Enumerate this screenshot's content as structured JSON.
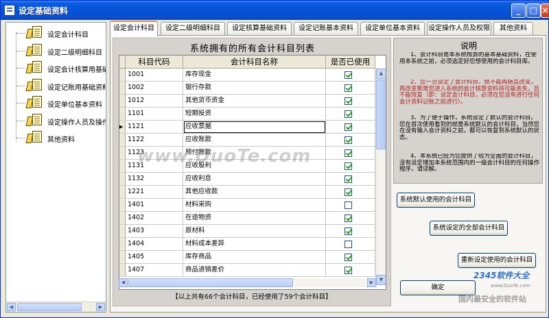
{
  "window": {
    "title": "设定基础资料",
    "min": "_",
    "max": "□",
    "close": "×"
  },
  "tree": {
    "items": [
      {
        "label": "设定会计科目"
      },
      {
        "label": "设定二级明细科目"
      },
      {
        "label": "设定会计核算用基础"
      },
      {
        "label": "设定记账用基础资料"
      },
      {
        "label": "设定单位基本资料"
      },
      {
        "label": "设定操作人员及操作"
      },
      {
        "label": "其他资料"
      }
    ]
  },
  "tabs": [
    {
      "label": "设定会计科目",
      "active": true
    },
    {
      "label": "设定二级明细科目"
    },
    {
      "label": "设定核算基础资料"
    },
    {
      "label": "设定记账基本资料"
    },
    {
      "label": "设定单位基本资料"
    },
    {
      "label": "设定操作人员及权限"
    },
    {
      "label": "其他资料"
    }
  ],
  "grid": {
    "title": "系统拥有的所有会计科目列表",
    "columns": [
      "科目代码",
      "会计科目名称",
      "是否已使用"
    ],
    "rows": [
      {
        "code": "1001",
        "name": "库存现金",
        "used": true
      },
      {
        "code": "1002",
        "name": "银行存款",
        "used": true
      },
      {
        "code": "1012",
        "name": "其他货币资金",
        "used": true
      },
      {
        "code": "1101",
        "name": "短期投资",
        "used": true
      },
      {
        "code": "1121",
        "name": "应收票据",
        "used": true,
        "current": true
      },
      {
        "code": "1122",
        "name": "应收账款",
        "used": true
      },
      {
        "code": "1123",
        "name": "预付账款",
        "used": true
      },
      {
        "code": "1131",
        "name": "应收股利",
        "used": true
      },
      {
        "code": "1132",
        "name": "应收利息",
        "used": true
      },
      {
        "code": "1221",
        "name": "其他应收款",
        "used": true
      },
      {
        "code": "1401",
        "name": "材料采购",
        "used": false
      },
      {
        "code": "1402",
        "name": "在途物资",
        "used": true
      },
      {
        "code": "1403",
        "name": "原材料",
        "used": true
      },
      {
        "code": "1404",
        "name": "材料成本差异",
        "used": false
      },
      {
        "code": "1405",
        "name": "库存商品",
        "used": true
      },
      {
        "code": "1407",
        "name": "商品进销差价",
        "used": true
      }
    ],
    "row_marker": "▶",
    "footer": "【以上共有66个会计科目，已经使用了59个会计科目】"
  },
  "note": {
    "title": "说明",
    "p1": "1、会计科目是本系统核算的基本基础资料，在使用本系统之前，必须选定好您想使用的会计科目库。",
    "p2": "2、您一旦设定了会计科目，就不能再随意改变，再改变那是您进入系统的会计核算资料将可能丢失，且不能恢复（即：设定会计科目，必须在您没有进行任何会计资料记账之前进行）。",
    "p3": "3、为了便于操作，系统设定了默认的会计科目。您在首次使用看到的就是系统默认的会计科目，当然您在没有输入会计资料之前，都可以恢复到系统默认的状态。",
    "p4": "4、本系统已经为您提供了较为全面的会计科目，没有设定增加本系统范围内的一级会计科目的任何操作程序，请谅解。"
  },
  "buttons": {
    "default_accounts": "系统默认使用的会计科目",
    "all_accounts": "系统设定的全部会计科目",
    "reset_accounts": "重新设定使用的会计科目",
    "ok": "确定"
  },
  "watermarks": {
    "center": "www.DuoTe.com",
    "logo": "2345软件大全",
    "logo_url": "www.DuoTe.com",
    "logo_caption": "国内最安全的软件站"
  },
  "colors": {
    "titlebar": "#0453d8",
    "active_tab_accent": "#e68b2c",
    "note_red": "#b22222",
    "check_green": "#21a121"
  }
}
